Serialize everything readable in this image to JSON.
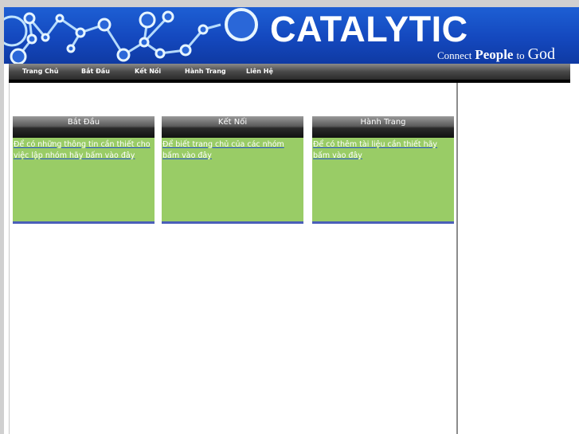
{
  "brand": {
    "title": "CATALYTIC",
    "tagline": {
      "connect": "Connect",
      "people": "People",
      "to": "to",
      "god": "God"
    }
  },
  "nav": {
    "items": [
      {
        "label": "Trang Chủ"
      },
      {
        "label": "Bắt Đầu"
      },
      {
        "label": "Kết Nối"
      },
      {
        "label": "Hành Trang"
      },
      {
        "label": "Liên Hệ"
      }
    ]
  },
  "panels": [
    {
      "title": "Bắt Đầu",
      "link": "Để có những thông tin cần thiết cho việc lập nhóm hãy bấm vào đây"
    },
    {
      "title": "Kết Nối",
      "link": "Để biết trang chủ của các nhóm bấm vào đây"
    },
    {
      "title": "Hành Trang",
      "link": "Để có thêm tài liệu cần thiết hãy bấm vào đây"
    }
  ],
  "colors": {
    "banner": "#1448be",
    "panel_body": "#99cc66",
    "panel_bottom": "#4a5fb8"
  },
  "icons": {
    "banner_graphic": "molecule-icon"
  }
}
